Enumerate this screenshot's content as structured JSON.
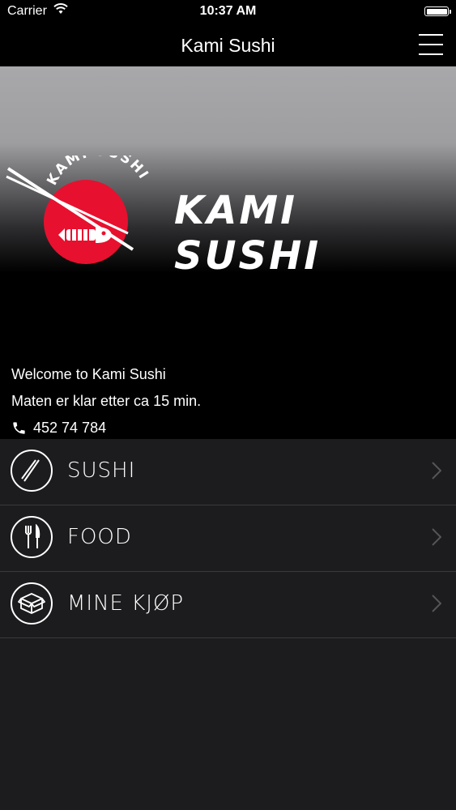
{
  "status_bar": {
    "carrier": "Carrier",
    "time": "10:37 AM"
  },
  "nav": {
    "title": "Kami Sushi"
  },
  "hero": {
    "logo_arc_text": "KAMI SUSHI",
    "wordmark": "KAMI SUSHI",
    "welcome": "Welcome to Kami Sushi",
    "wait_time": "Maten er klar etter ca 15 min.",
    "phone": "452 74 784"
  },
  "menu": {
    "items": [
      {
        "label": "SUSHI",
        "icon": "chopsticks-icon"
      },
      {
        "label": "FOOD",
        "icon": "fork-knife-icon"
      },
      {
        "label": "MINE KJØP",
        "icon": "box-icon"
      }
    ]
  },
  "colors": {
    "background": "#1c1c1e",
    "bar": "#000000",
    "logo_red": "#e8102f",
    "divider": "#3a3a3c"
  }
}
